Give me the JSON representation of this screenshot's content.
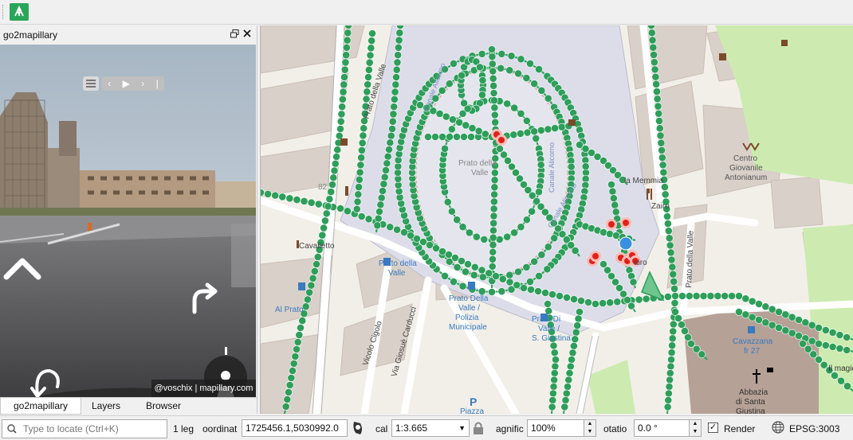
{
  "dock": {
    "title": "go2mapillary",
    "float_icon": "float-icon",
    "close_icon": "close-icon",
    "tabs": [
      "go2mapillary",
      "Layers",
      "Browser"
    ],
    "active_tab": 0
  },
  "viewer": {
    "credit": "@voschix | mapillary.com",
    "controls": [
      "menu-icon",
      "prev-icon",
      "play-icon",
      "next-icon",
      "skip-icon"
    ]
  },
  "map": {
    "labels": {
      "prato_diag": "Prato della Valle",
      "prato_center_1": "Prato della",
      "prato_center_2": "Valle",
      "canale1": "Canale Alicorno",
      "canale2": "Canale Alicorno",
      "canale3": "Canale Alicorno",
      "memmia": "la Memmia",
      "zairo1": "Zairo",
      "zairo2": "airo",
      "cavalletto": "Cavalletto",
      "prato_stop_1": "Prato della",
      "prato_stop_2": "Valle",
      "alpiato": "Al Prato",
      "polizia_1": "Prato Della",
      "polizia_2": "Valle /",
      "polizia_3": "Polizia",
      "polizia_4": "Municipale",
      "giustina_1": "Prato Di",
      "giustina_2": "Valle /",
      "giustina_3": "S. Giustina",
      "cigolo": "Vicolo Cigolo",
      "carducci": "Via Giosuè Carducci",
      "piazza": "Piazza",
      "centro_1": "Centro",
      "centro_2": "Giovanile",
      "centro_3": "Antonianum",
      "prato_right": "Prato della Valle",
      "cavazzana_1": "Cavazzana",
      "cavazzana_2": "fr 27",
      "abbazia_1": "Abbazia",
      "abbazia_2": "di Santa",
      "abbazia_3": "Giustina",
      "magic": "Il magic",
      "num82": "82"
    },
    "colors": {
      "background": "#f2efe9",
      "building": "#d9d0c9",
      "square": "#ddddea",
      "park": "#cdebb0",
      "track": "#2e9e5a",
      "highlight": "#e0201b",
      "location": "#3b8fe0",
      "church": "#b5a196",
      "label": "#3a7abf"
    }
  },
  "statusbar": {
    "locate_placeholder": "Type to locate (Ctrl+K)",
    "legend": "1 leg",
    "coordinate_label": "oordinat",
    "coordinate_value": "1725456.1,5030992.0",
    "scale_label": "cal",
    "scale_value": "1:3.665",
    "magnifier_label": "agnific",
    "magnifier_value": "100%",
    "rotation_label": "otatio",
    "rotation_value": "0.0 °",
    "render_label": "Render",
    "render_checked": true,
    "crs": "EPSG:3003"
  }
}
